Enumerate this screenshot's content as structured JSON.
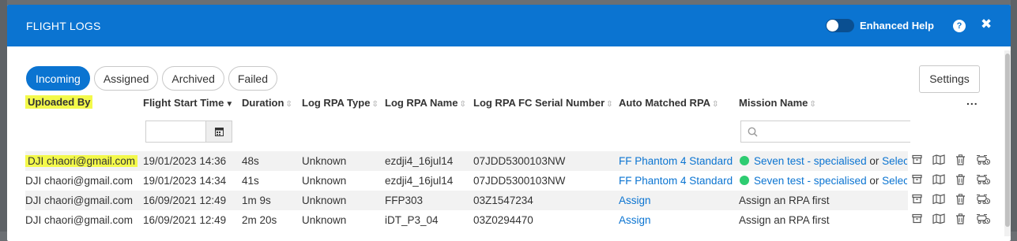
{
  "header": {
    "title": "FLIGHT LOGS",
    "enhanced_help_label": "Enhanced Help",
    "help_glyph": "?",
    "close_glyph": "✖"
  },
  "tabs": [
    {
      "label": "Incoming",
      "active": true
    },
    {
      "label": "Assigned",
      "active": false
    },
    {
      "label": "Archived",
      "active": false
    },
    {
      "label": "Failed",
      "active": false
    }
  ],
  "settings_label": "Settings",
  "columns": {
    "uploaded_by": "Uploaded By",
    "flight_start_time": "Flight Start Time",
    "duration": "Duration",
    "log_rpa_type": "Log RPA Type",
    "log_rpa_name": "Log RPA Name",
    "log_rpa_fc_serial": "Log RPA FC Serial Number",
    "auto_matched_rpa": "Auto Matched RPA",
    "mission_name": "Mission Name",
    "more": "..."
  },
  "filters": {
    "date_value": "",
    "mission_search_value": ""
  },
  "rows": [
    {
      "uploaded_by": "DJI chaori@gmail.com",
      "start_time": "19/01/2023 14:36",
      "duration": "48s",
      "rpa_type": "Unknown",
      "rpa_name": "ezdji4_16jul14",
      "serial": "07JDD5300103NW",
      "auto_matched": "FF Phantom 4 Standard",
      "mission_link": "Seven test - specialised",
      "mission_or": "or",
      "mission_select": "Select",
      "mission_text": ""
    },
    {
      "uploaded_by": "DJI chaori@gmail.com",
      "start_time": "19/01/2023 14:34",
      "duration": "41s",
      "rpa_type": "Unknown",
      "rpa_name": "ezdji4_16jul14",
      "serial": "07JDD5300103NW",
      "auto_matched": "FF Phantom 4 Standard",
      "mission_link": "Seven test - specialised",
      "mission_or": "or",
      "mission_select": "Select",
      "mission_text": ""
    },
    {
      "uploaded_by": "DJI chaori@gmail.com",
      "start_time": "16/09/2021 12:49",
      "duration": "1m 9s",
      "rpa_type": "Unknown",
      "rpa_name": "FFP303",
      "serial": "03Z1547234",
      "auto_matched": "Assign",
      "mission_link": "",
      "mission_or": "",
      "mission_select": "",
      "mission_text": "Assign an RPA first"
    },
    {
      "uploaded_by": "DJI chaori@gmail.com",
      "start_time": "16/09/2021 12:49",
      "duration": "2m 20s",
      "rpa_type": "Unknown",
      "rpa_name": "iDT_P3_04",
      "serial": "03Z0294470",
      "auto_matched": "Assign",
      "mission_link": "",
      "mission_or": "",
      "mission_select": "",
      "mission_text": "Assign an RPA first"
    }
  ],
  "row_icons": [
    "archive-icon",
    "map-icon",
    "trash-icon",
    "drone-icon"
  ],
  "colors": {
    "primary": "#0b74d1",
    "highlight": "#f3f94a",
    "status_green": "#2ecc71"
  }
}
